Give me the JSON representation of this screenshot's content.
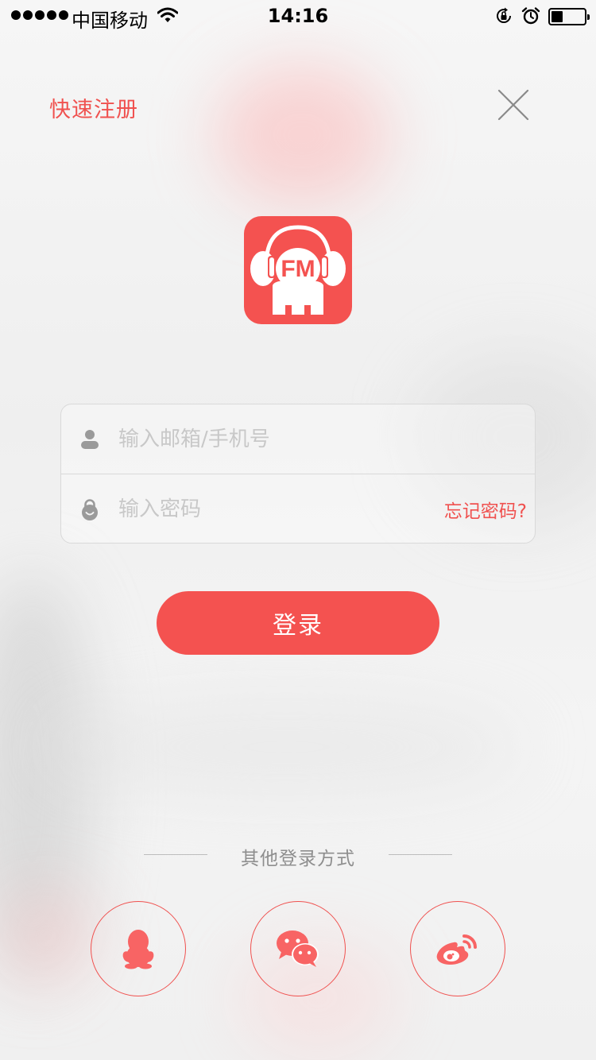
{
  "status_bar": {
    "carrier": "中国移动",
    "time": "14:16",
    "battery_level": 0.35
  },
  "header": {
    "register_label": "快速注册"
  },
  "form": {
    "account_placeholder": "输入邮箱/手机号",
    "password_placeholder": "输入密码",
    "forgot_label": "忘记密码?"
  },
  "login": {
    "button_label": "登录"
  },
  "other_login": {
    "label": "其他登录方式"
  },
  "icons": {
    "account": "user-icon",
    "password": "lock-icon",
    "close": "close-icon",
    "qq": "qq-icon",
    "wechat": "wechat-icon",
    "weibo": "weibo-icon"
  },
  "colors": {
    "accent": "#f45250",
    "link": "#f0514f",
    "placeholder": "#c8c8c8"
  }
}
